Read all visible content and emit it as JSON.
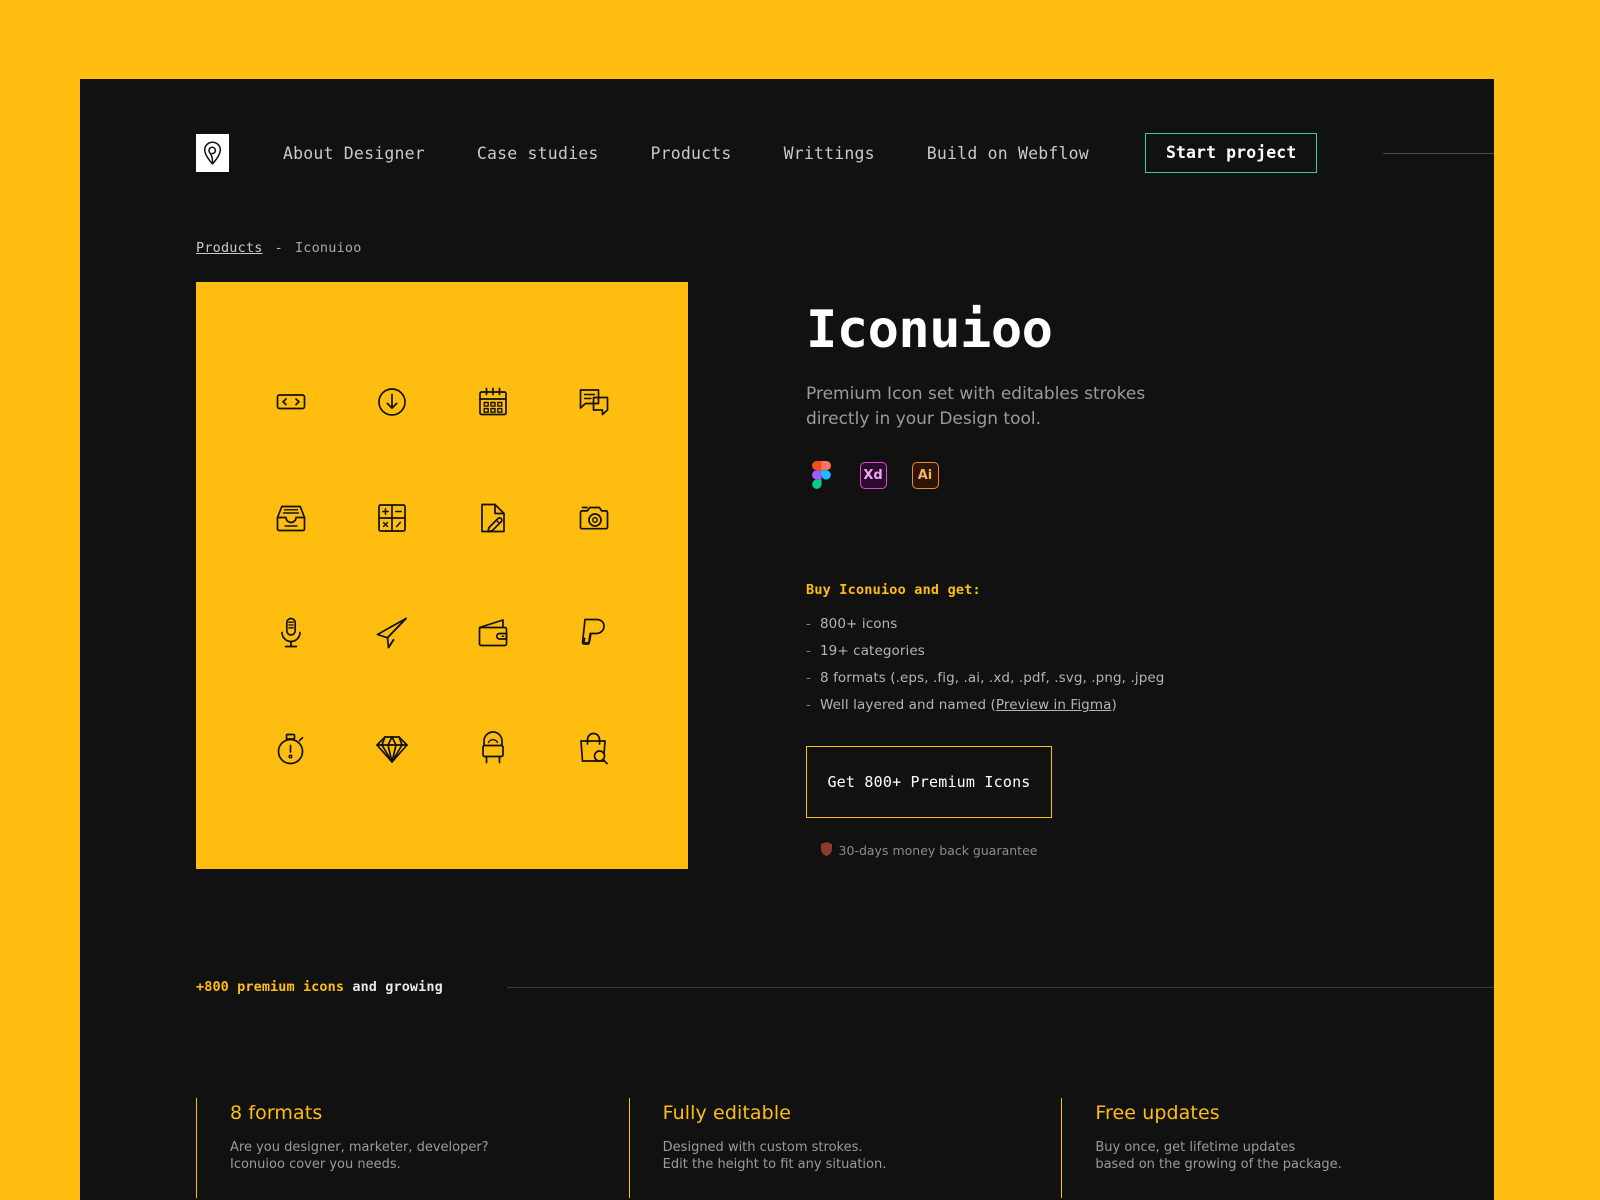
{
  "theme": {
    "brand_yellow": "#FFBE0F",
    "card_dark": "#111111",
    "accent_green": "#3ECB96",
    "muted_text": "#9B9B9B"
  },
  "header": {
    "logo_icon": "location-pin-logo-icon",
    "nav": [
      {
        "label": "About Designer"
      },
      {
        "label": "Case studies"
      },
      {
        "label": "Products"
      },
      {
        "label": "Writtings"
      },
      {
        "label": "Build on Webflow"
      }
    ],
    "cta_label": "Start project"
  },
  "breadcrumb": {
    "parent": "Products",
    "separator": "-",
    "current": "Iconuioo"
  },
  "showcase": {
    "background": "#FFBE0F",
    "icons": [
      {
        "name": "code-brackets-icon"
      },
      {
        "name": "download-circle-icon"
      },
      {
        "name": "calendar-icon"
      },
      {
        "name": "chat-bubbles-icon"
      },
      {
        "name": "inbox-tray-icon"
      },
      {
        "name": "calculator-icon"
      },
      {
        "name": "edit-document-icon"
      },
      {
        "name": "camera-icon"
      },
      {
        "name": "microphone-icon"
      },
      {
        "name": "paper-plane-icon"
      },
      {
        "name": "wallet-icon"
      },
      {
        "name": "paypal-icon"
      },
      {
        "name": "stopwatch-alert-icon"
      },
      {
        "name": "diamond-icon"
      },
      {
        "name": "chair-icon"
      },
      {
        "name": "shopping-bag-search-icon"
      }
    ]
  },
  "product": {
    "title": "Iconuioo",
    "subtitle": "Premium Icon set with editables strokes directly in your Design tool.",
    "formats": [
      {
        "name": "figma-icon",
        "label": "Figma"
      },
      {
        "name": "adobe-xd-icon",
        "label": "Xd"
      },
      {
        "name": "adobe-illustrator-icon",
        "label": "Ai"
      }
    ],
    "buy_heading": "Buy Iconuioo and get:",
    "buy_items": [
      {
        "bullet": "-",
        "text": "800+ icons",
        "link": null
      },
      {
        "bullet": "-",
        "text": "19+ categories",
        "link": null
      },
      {
        "bullet": "-",
        "text": "8 formats (.eps, .fig, .ai, .xd, .pdf, .svg, .png, .jpeg",
        "link": null
      },
      {
        "bullet": "-",
        "prefix": "Well layered and named (",
        "link": "Preview in Figma",
        "suffix": ")"
      }
    ],
    "cta_label": "Get 800+ Premium Icons",
    "guarantee_icon": "shield-icon",
    "guarantee_text": "30-days money back guarantee"
  },
  "growing": {
    "accent": "+800 premium icons",
    "plain": " and growing"
  },
  "features": [
    {
      "title": "8 formats",
      "body": "Are you designer, marketer, developer?\nIconuioo cover you needs."
    },
    {
      "title": "Fully editable",
      "body": "Designed with custom strokes.\nEdit the height to fit any situation."
    },
    {
      "title": "Free updates",
      "body": "Buy once, get lifetime updates\nbased on the growing of the package."
    }
  ]
}
